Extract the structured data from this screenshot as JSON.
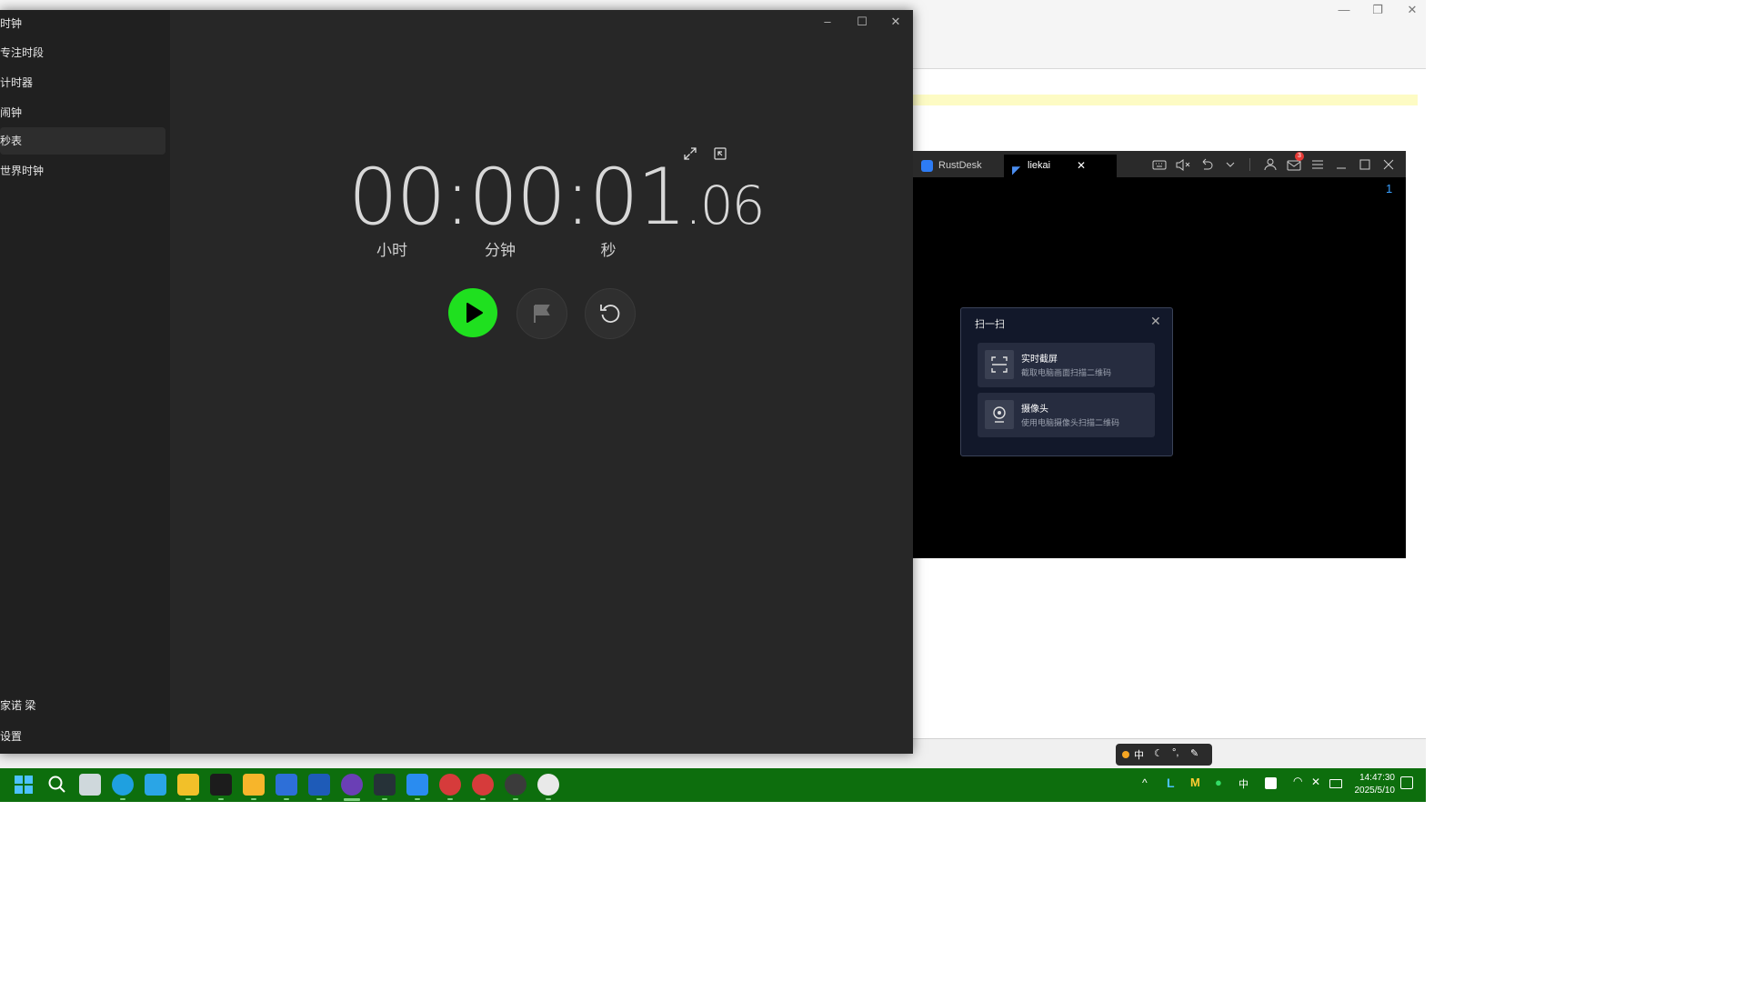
{
  "clock_app": {
    "nav": {
      "items": [
        {
          "label": "时钟",
          "active": false
        },
        {
          "label": "专注时段",
          "active": false
        },
        {
          "label": "计时器",
          "active": false
        },
        {
          "label": "闹钟",
          "active": false
        },
        {
          "label": "秒表",
          "active": true
        },
        {
          "label": "世界时钟",
          "active": false
        }
      ],
      "user": "家诺 梁",
      "settings": "设置"
    },
    "stopwatch": {
      "hours": "00",
      "sep1": ":",
      "minutes": "00",
      "sep2": ":",
      "seconds": "01",
      "fraction": ".06",
      "label_hours": "小时",
      "label_minutes": "分钟",
      "label_seconds": "秒"
    },
    "colors": {
      "play_accent": "#1fe01f"
    }
  },
  "rustdesk": {
    "tabs": [
      {
        "label": "RustDesk",
        "active": false
      },
      {
        "label": "liekai",
        "active": true
      }
    ],
    "mail_badge": "3",
    "monitor_number": "1"
  },
  "scan_dialog": {
    "title": "扫一扫",
    "options": [
      {
        "title": "实时截屏",
        "subtitle": "截取电脑画面扫描二维码",
        "icon": "scan-frame-icon"
      },
      {
        "title": "摄像头",
        "subtitle": "使用电脑摄像头扫描二维码",
        "icon": "camera-icon"
      }
    ]
  },
  "ime": {
    "mode": "中"
  },
  "tray": {
    "ime_label": "中",
    "time": "14:47:30",
    "date": "2025/5/10"
  },
  "taskbar": {
    "colors": {
      "background": "#0d6e0d"
    }
  }
}
